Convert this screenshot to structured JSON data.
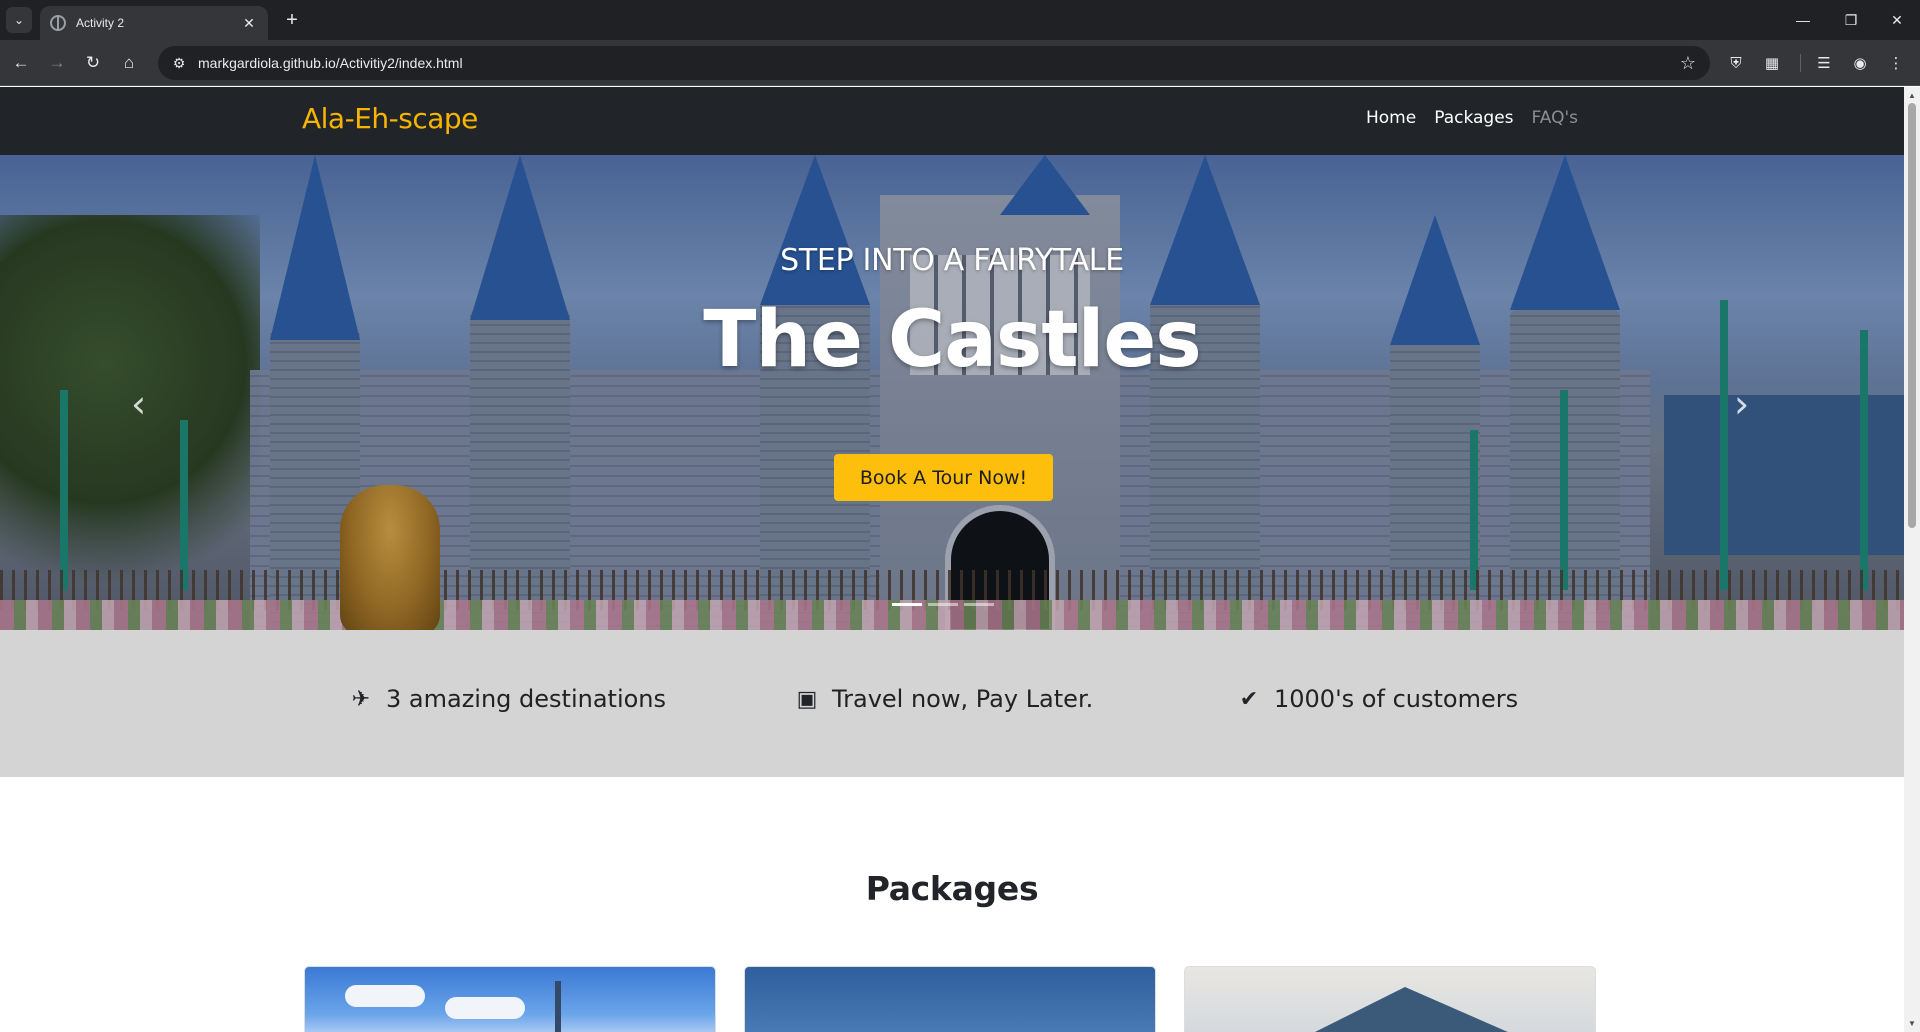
{
  "browser": {
    "tab_title": "Activity 2",
    "url": "markgardiola.github.io/Activitiy2/index.html"
  },
  "site": {
    "brand": "Ala-Eh-scape",
    "nav": [
      "Home",
      "Packages",
      "FAQ's"
    ]
  },
  "hero": {
    "subtitle": "STEP INTO A FAIRYTALE",
    "title": "The Castles",
    "button_label": "Book A Tour Now!",
    "slides_count": 3,
    "active_slide": 1
  },
  "features": [
    {
      "icon": "plane-icon",
      "text": "3 amazing destinations"
    },
    {
      "icon": "wallet-icon",
      "text": "Travel now, Pay Later."
    },
    {
      "icon": "verified-badge-icon",
      "text": "1000's of customers"
    }
  ],
  "packages": {
    "heading": "Packages"
  },
  "colors": {
    "brand": "#f7b500",
    "navbar": "#212529",
    "button": "#fdbf0b",
    "features_bg": "#d4d4d4"
  }
}
